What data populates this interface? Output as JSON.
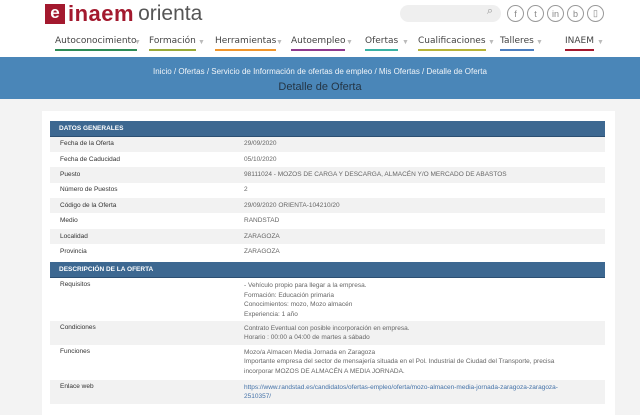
{
  "header": {
    "logo_e": "e",
    "logo_inaem": "inaem",
    "logo_orienta": "orienta",
    "search_placeholder": "",
    "social": [
      "f",
      "t",
      "in",
      "b",
      "▯"
    ]
  },
  "nav": [
    {
      "label": "Autoconocimiento",
      "color": "#2e8b57"
    },
    {
      "label": "Formación",
      "color": "#9aaa3a"
    },
    {
      "label": "Herramientas",
      "color": "#f0962d"
    },
    {
      "label": "Autoempleo",
      "color": "#8e3a8e"
    },
    {
      "label": "Ofertas",
      "color": "#3ab2a4"
    },
    {
      "label": "Cualificaciones",
      "color": "#b7b43a"
    },
    {
      "label": "Talleres",
      "color": "#4d7fc0"
    },
    {
      "label": "INAEM",
      "color": "#a3192e"
    }
  ],
  "breadcrumb": [
    "Inicio",
    "Ofertas",
    "Servicio de Información de ofertas de empleo",
    "Mis Ofertas",
    "Detalle de Oferta"
  ],
  "page_title": "Detalle de Oferta",
  "general": {
    "title": "DATOS GENERALES",
    "rows": [
      {
        "k": "Fecha de la Oferta",
        "v": "29/09/2020"
      },
      {
        "k": "Fecha de Caducidad",
        "v": "05/10/2020"
      },
      {
        "k": "Puesto",
        "v": "98111024 - MOZOS DE CARGA Y DESCARGA, ALMACÉN Y/O MERCADO DE ABASTOS"
      },
      {
        "k": "Número de Puestos",
        "v": "2"
      },
      {
        "k": "Código de la Oferta",
        "v": "29/09/2020 ORIENTA-104210/20"
      },
      {
        "k": "Medio",
        "v": "RANDSTAD"
      },
      {
        "k": "Localidad",
        "v": "ZARAGOZA"
      },
      {
        "k": "Provincia",
        "v": "ZARAGOZA"
      }
    ]
  },
  "description": {
    "title": "DESCRIPCIÓN DE LA OFERTA",
    "rows": [
      {
        "k": "Requisitos",
        "lines": [
          "- Vehículo propio para llegar a la empresa.",
          "Formación: Educación primaria",
          "Conocimientos: mozo, Mozo almacén",
          "Experiencia: 1 año"
        ]
      },
      {
        "k": "Condiciones",
        "lines": [
          "Contrato Eventual con posible incorporación en empresa.",
          "Horario : 00:00 a 04:00 de martes a sábado"
        ]
      },
      {
        "k": "Funciones",
        "lines": [
          "Mozo/a Almacen Media Jornada en Zaragoza",
          "Importante empresa del sector de mensajería situada en el Pol. Industrial de Ciudad del Transporte, precisa",
          "incorporar MOZOS DE ALMACÉN A MEDIA JORNADA."
        ]
      },
      {
        "k": "Enlace web",
        "lines": [
          "https://www.randstad.es/candidatos/ofertas-empleo/oferta/mozo-almacen-media-jornada-zaragoza-zaragoza-",
          "2510357/"
        ]
      }
    ]
  }
}
